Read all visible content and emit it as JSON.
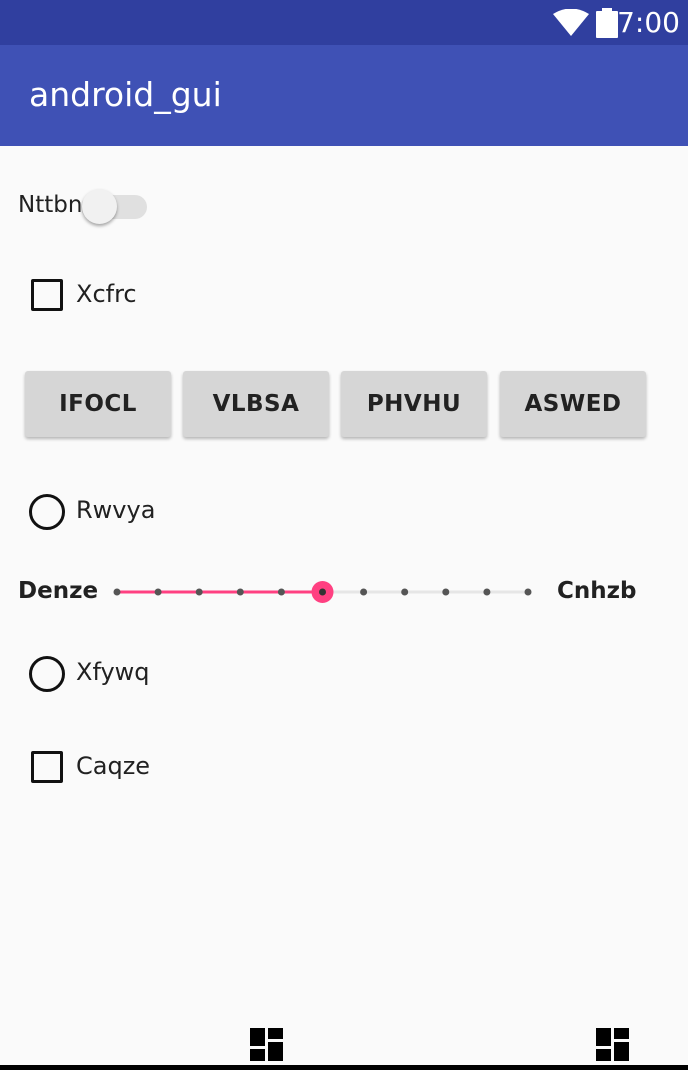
{
  "status_bar": {
    "time": "7:00",
    "wifi_icon": "wifi-icon",
    "battery_icon": "battery-icon"
  },
  "app_bar": {
    "title": "android_gui"
  },
  "switch": {
    "label": "Nttbn",
    "checked": false
  },
  "checkbox_1": {
    "label": "Xcfrc",
    "checked": false
  },
  "buttons": [
    {
      "label": "IFOCL"
    },
    {
      "label": "VLBSA"
    },
    {
      "label": "PHVHU"
    },
    {
      "label": "ASWED"
    }
  ],
  "radio_1": {
    "label": "Rwvya",
    "selected": false
  },
  "seekbar": {
    "left_label": "Denze",
    "right_label": "Cnhzb",
    "max": 10,
    "value": 5
  },
  "radio_2": {
    "label": "Xfywq",
    "selected": false
  },
  "checkbox_2": {
    "label": "Caqze",
    "checked": false
  },
  "nav_bar": {
    "icons": [
      "dashboard-icon",
      "dashboard-icon"
    ]
  },
  "colors": {
    "primary": "#3f51b5",
    "primary_dark": "#303f9f",
    "accent": "#ff4081",
    "background": "#fafafa"
  }
}
